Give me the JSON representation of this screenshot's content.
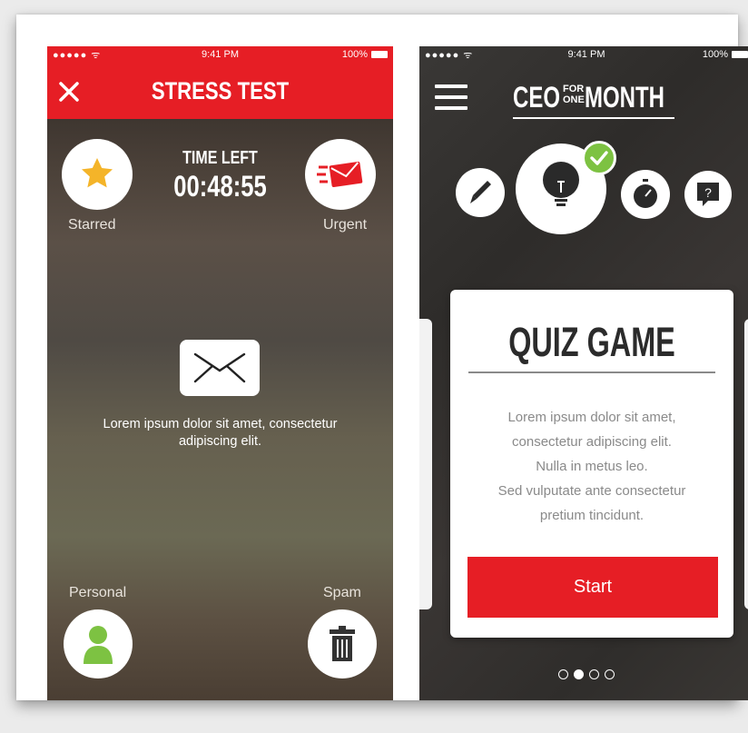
{
  "screen1": {
    "status": {
      "signal": "●●●●● ᯤ",
      "time": "9:41 PM",
      "battery": "100%"
    },
    "title": "STRESS TEST",
    "close_icon": "close-icon",
    "timer": {
      "label": "TIME LEFT",
      "value": "00:48:55"
    },
    "starred_label": "Starred",
    "urgent_label": "Urgent",
    "message": "Lorem ipsum dolor sit amet, consectetur adipiscing elit.",
    "personal_label": "Personal",
    "spam_label": "Spam",
    "colors": {
      "accent": "#e61e25",
      "star": "#f4b429",
      "person": "#7dc242"
    }
  },
  "screen2": {
    "status": {
      "signal": "●●●●● ᯤ",
      "time": "9:41 PM",
      "battery": "100%"
    },
    "logo": {
      "part1": "CEO",
      "part2_top": "FOR",
      "part2_bottom": "ONE",
      "part3": "MONTH"
    },
    "tools": [
      "pen-icon",
      "lightbulb-icon",
      "stopwatch-icon",
      "question-bubble-icon"
    ],
    "card": {
      "title": "QUIZ GAME",
      "body_lines": [
        "Lorem ipsum dolor sit amet,",
        "consectetur adipiscing elit.",
        "Nulla in metus leo.",
        "Sed vulputate ante consectetur",
        "pretium tincidunt."
      ],
      "button": "Start"
    },
    "pagination": {
      "total": 4,
      "active": 2
    },
    "colors": {
      "accent": "#e61e25",
      "check": "#7dc242"
    }
  }
}
